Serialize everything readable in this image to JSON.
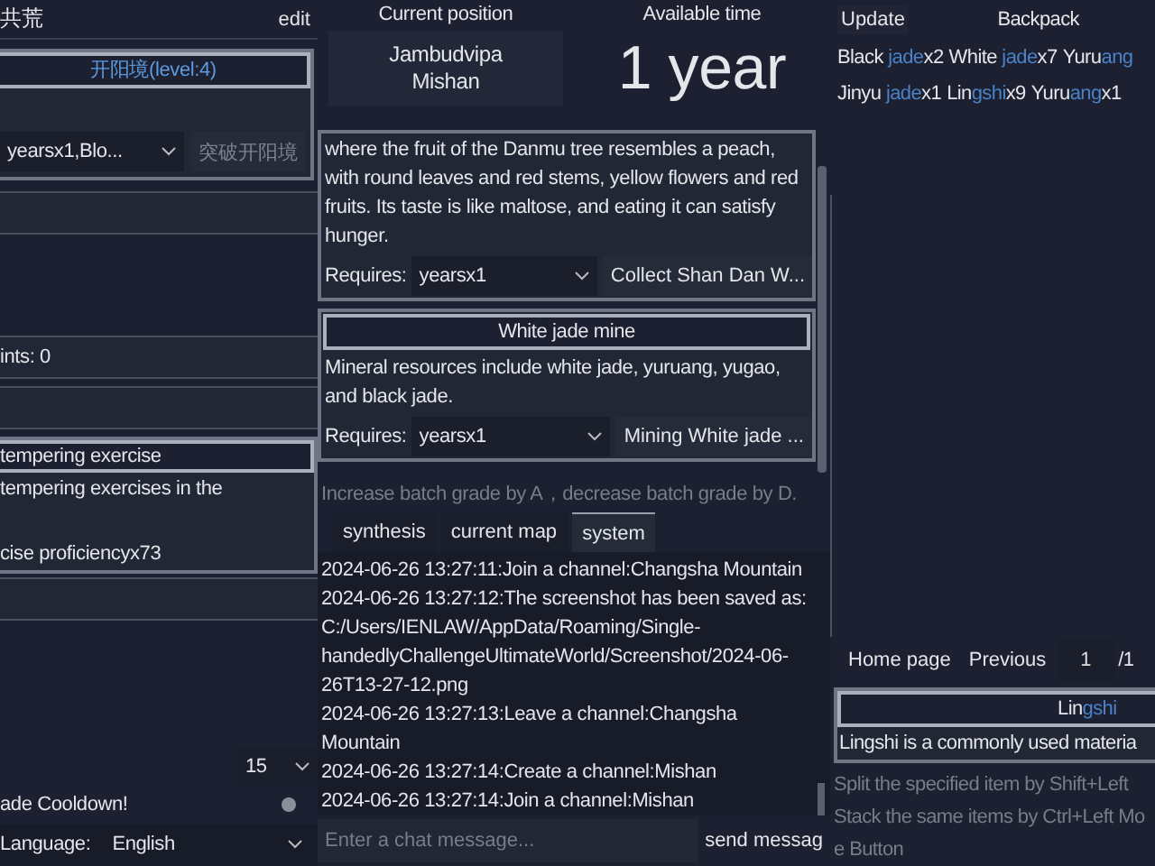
{
  "left": {
    "title": "共荒",
    "edit": "edit",
    "realm": {
      "title": "开阳境(level:4)",
      "requirement": "yearsx1,Blo...",
      "breakthrough": {
        "label": "突破开阳境",
        "disabled": true
      }
    },
    "points": "ints: 0",
    "exercise": {
      "title": "tempering exercise",
      "lines": [
        "tempering exercises in the",
        "cise proficiencyx73"
      ]
    },
    "batch": "15",
    "cooldown": {
      "label": "ade Cooldown!",
      "on": false
    },
    "language": {
      "label": "Language:",
      "value": "English"
    }
  },
  "middle": {
    "position_label": "Current position",
    "position": [
      "Jambudvipa",
      "Mishan"
    ],
    "time_label": "Available time",
    "time": "1 year",
    "places": [
      {
        "description": "where the fruit of the Danmu tree resembles a peach, with round leaves and red stems, yellow flowers and red fruits.  Its taste is like maltose, and eating it can satisfy hunger.",
        "requires_label": "Requires:",
        "requires": "yearsx1",
        "action": "Collect Shan Dan W..."
      },
      {
        "title": "White jade mine",
        "description": "Mineral resources include white jade, yuruang, yugao, and black jade.",
        "requires_label": "Requires:",
        "requires": "yearsx1",
        "action": "Mining White jade ..."
      }
    ],
    "hint": "Increase batch grade by A，decrease batch grade by D.",
    "tabs": [
      {
        "label": "synthesis",
        "selected": false
      },
      {
        "label": "current map",
        "selected": false
      },
      {
        "label": "system",
        "selected": true
      }
    ],
    "log": [
      "2024-06-26 13:27:11:Join a channel:Changsha Mountain",
      "2024-06-26 13:27:12:The screenshot has been saved as: C:/Users/IENLAW/AppData/Roaming/Single-handedlyChallengeUltimateWorld/Screenshot/2024-06-26T13-27-12.png",
      "2024-06-26 13:27:13:Leave a channel:Changsha Mountain",
      "2024-06-26 13:27:14:Create a channel:Mishan",
      "2024-06-26 13:27:14:Join a channel:Mishan"
    ],
    "chat": {
      "placeholder": "Enter a chat message..."
    },
    "send": "send messag"
  },
  "right": {
    "update": "Update",
    "backpack": "Backpack",
    "rows": [
      [
        {
          "before": "Black ",
          "match": "jade",
          "after": "x2"
        },
        {
          "before": "White ",
          "match": "jade",
          "after": "x7"
        },
        {
          "before": "Yuru",
          "match": "ang"
        }
      ],
      [
        {
          "before": "Jinyu ",
          "match": "jade",
          "after": "x1"
        },
        {
          "before": "Lin",
          "match": "gshi",
          "after": "x9"
        },
        {
          "before": "Yuru",
          "match": "ang",
          "after": "x1"
        }
      ]
    ],
    "pager": {
      "home": "Home page",
      "previous": "Previous",
      "page": "1",
      "total": "/1"
    },
    "detail": {
      "title": {
        "before": "Lin",
        "match": "gshi"
      },
      "description": "Lingshi is a commonly used materia"
    },
    "tips": [
      "Split the specified item by Shift+Left",
      "Stack the same items by Ctrl+Left Mo",
      "e Button"
    ]
  }
}
